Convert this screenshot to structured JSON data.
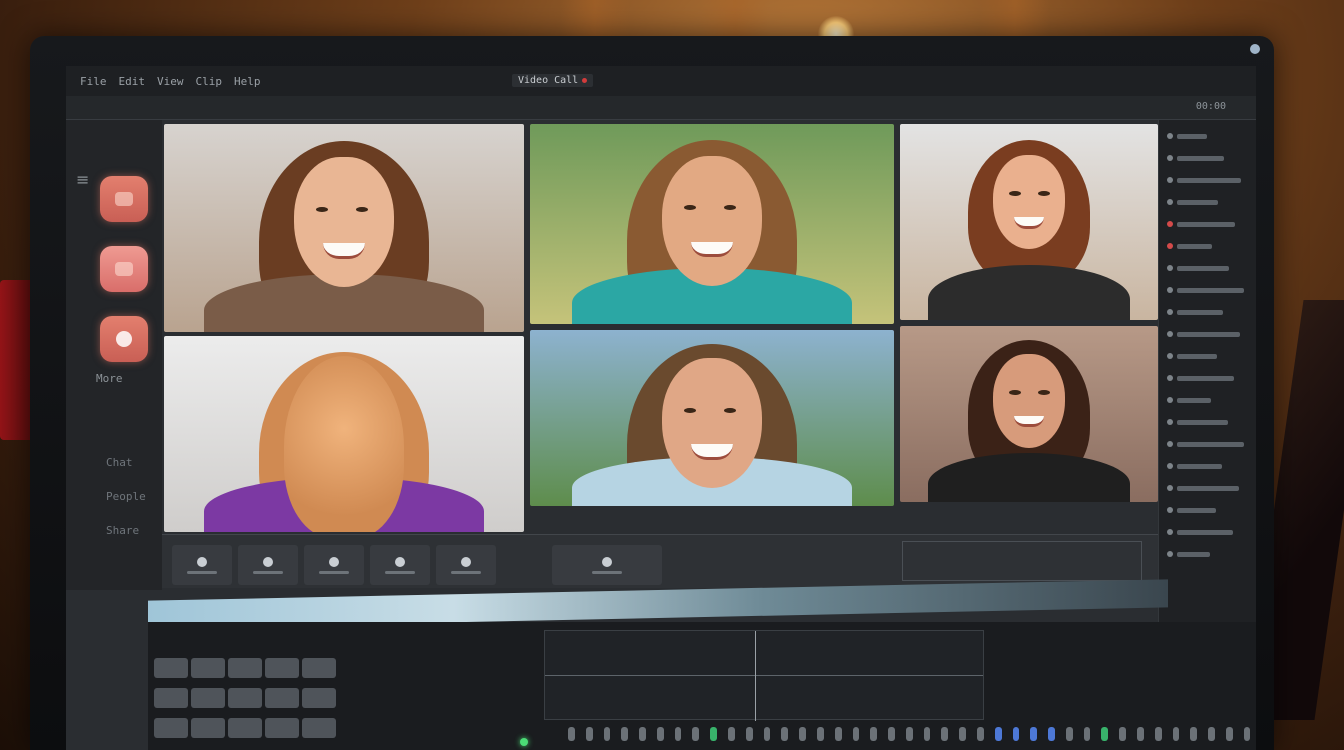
{
  "app": {
    "menu_items": [
      "File",
      "Edit",
      "View",
      "Clip",
      "Help"
    ],
    "window_title": "Video Call"
  },
  "toolbar": {
    "right_label": "00:00"
  },
  "sidebar": {
    "buttons": [
      {
        "name": "camera-button"
      },
      {
        "name": "mic-button"
      },
      {
        "name": "screen-share-button"
      }
    ],
    "labels": [
      "Chat",
      "People",
      "Share",
      "More"
    ]
  },
  "participants": [
    {
      "name": "",
      "skin": "#e9b694",
      "hair": "#6a3d22",
      "shirt": "#7a5c48",
      "bg": [
        "#d7d3cf",
        "#b9a38f"
      ],
      "facing": "front"
    },
    {
      "name": "",
      "skin": "#e2a983",
      "hair": "#8a5a32",
      "shirt": "#2ba7a4",
      "bg": [
        "#6f9a5a",
        "#c5c37a"
      ],
      "facing": "front"
    },
    {
      "name": "",
      "skin": "#eab08e",
      "hair": "#7a3d20",
      "shirt": "#2c2c2c",
      "bg": [
        "#e3e3e3",
        "#c9b5a0"
      ],
      "facing": "front"
    },
    {
      "name": "",
      "skin": "#e3a47c",
      "hair": "#d08a52",
      "shirt": "#7c39a3",
      "bg": [
        "#ececec",
        "#cfcdcb"
      ],
      "facing": "back"
    },
    {
      "name": "",
      "skin": "#e0a786",
      "hair": "#6a4a2e",
      "shirt": "#b6d4e3",
      "bg": [
        "#8db2cf",
        "#5e8d4c"
      ],
      "facing": "front"
    },
    {
      "name": "",
      "skin": "#d79b7b",
      "hair": "#3b2217",
      "shirt": "#1f1f1f",
      "bg": [
        "#b79987",
        "#8a6d60"
      ],
      "facing": "front"
    }
  ],
  "transport": {
    "info_lines": [
      "",
      ""
    ],
    "timeline_ticks": ""
  },
  "waveform": {
    "label_top": "",
    "label_mid": "",
    "label_bottom": ""
  },
  "right_panel": {
    "rows": [
      "",
      "",
      "",
      "",
      "",
      "",
      "",
      "",
      "",
      "",
      "",
      "",
      "",
      "",
      "",
      "",
      "",
      "",
      "",
      ""
    ]
  },
  "colors": {
    "accent": "#d96e6a",
    "panel_bg": "#1f2124",
    "screen_bg": "#2a2d31",
    "record_led": "#4bdc76"
  }
}
